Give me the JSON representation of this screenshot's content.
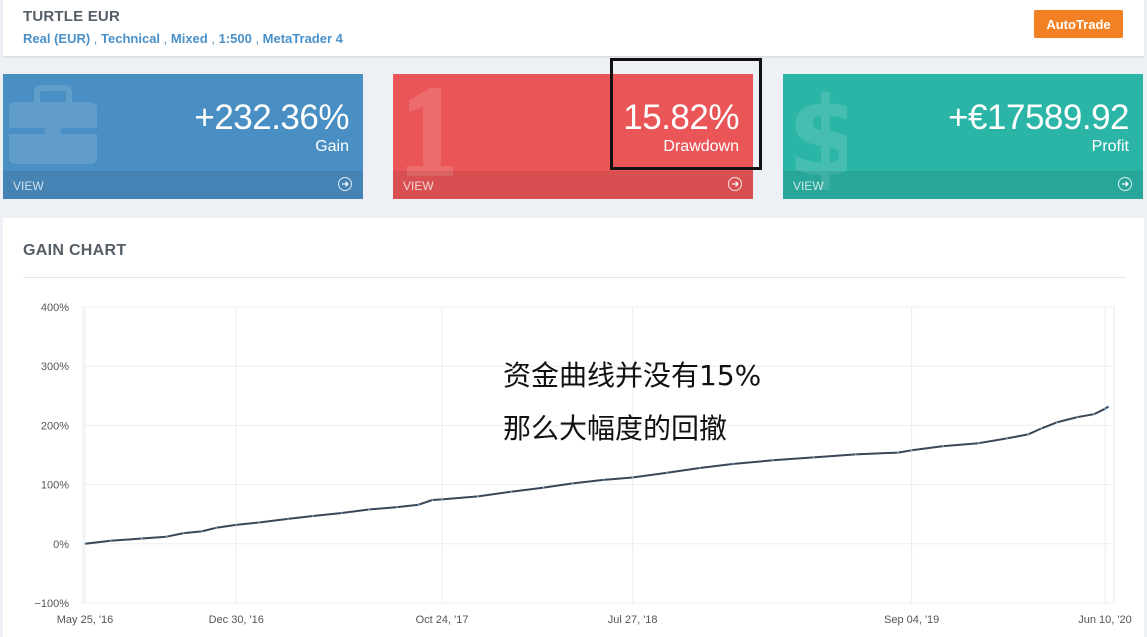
{
  "header": {
    "title": "TURTLE EUR",
    "account_type": "Real (EUR)",
    "system": "Technical",
    "trading": "Mixed",
    "leverage": "1:500",
    "platform": "MetaTrader 4",
    "autotrade_label": "AutoTrade",
    "autotrade_color": "#f48024"
  },
  "cards": [
    {
      "value": "+232.36%",
      "label": "Gain",
      "footer": "VIEW",
      "color": "#4a8fc3",
      "icon": "briefcase-icon"
    },
    {
      "value": "15.82%",
      "label": "Drawdown",
      "footer": "VIEW",
      "color": "#ea5658",
      "icon": "number-one-icon"
    },
    {
      "value": "+€17589.92",
      "label": "Profit",
      "footer": "VIEW",
      "color": "#2bb5a6",
      "icon": "dollar-icon"
    }
  ],
  "panel": {
    "title": "GAIN CHART"
  },
  "annotation": {
    "line1": "资金曲线并没有15%",
    "line2": "那么大幅度的回撤"
  },
  "chart_data": {
    "type": "line",
    "title": "",
    "xlabel": "",
    "ylabel": "",
    "ylim": [
      -100,
      400
    ],
    "yticks": [
      "400%",
      "300%",
      "200%",
      "100%",
      "0%",
      "−100%"
    ],
    "ytick_values": [
      400,
      300,
      200,
      100,
      0,
      -100
    ],
    "xticks": [
      "May 25, '16",
      "Dec 30, '16",
      "Oct 24, '17",
      "Jul 27, '18",
      "Sep 04, '19",
      "Jun 10, '20"
    ],
    "xtick_dates": [
      "2016-05-25",
      "2016-12-30",
      "2017-10-24",
      "2018-07-27",
      "2019-09-04",
      "2020-06-10"
    ],
    "grid": true,
    "line_color": "#3b4756",
    "series": [
      {
        "x": [
          "2016-05-25",
          "2016-07-01",
          "2016-08-15",
          "2016-09-20",
          "2016-10-15",
          "2016-11-10",
          "2016-12-01",
          "2016-12-30",
          "2017-02-01",
          "2017-03-15",
          "2017-04-20",
          "2017-06-01",
          "2017-07-10",
          "2017-08-20",
          "2017-09-20",
          "2017-10-10",
          "2017-10-24",
          "2017-12-15",
          "2018-02-01",
          "2018-03-20",
          "2018-05-01",
          "2018-06-15",
          "2018-07-27",
          "2018-09-15",
          "2018-11-01",
          "2018-12-20",
          "2019-02-15",
          "2019-04-15",
          "2019-06-15",
          "2019-08-15",
          "2019-09-04",
          "2019-10-20",
          "2019-12-10",
          "2020-01-20",
          "2020-02-20",
          "2020-03-10",
          "2020-04-01",
          "2020-05-01",
          "2020-05-25",
          "2020-06-10",
          "2020-06-15"
        ],
        "y": [
          0,
          5,
          9,
          12,
          18,
          21,
          27,
          32,
          36,
          42,
          47,
          52,
          58,
          62,
          66,
          74,
          75,
          80,
          88,
          95,
          102,
          108,
          112,
          120,
          128,
          135,
          141,
          146,
          151,
          154,
          158,
          165,
          170,
          178,
          185,
          195,
          205,
          214,
          219,
          228,
          232
        ]
      }
    ]
  }
}
